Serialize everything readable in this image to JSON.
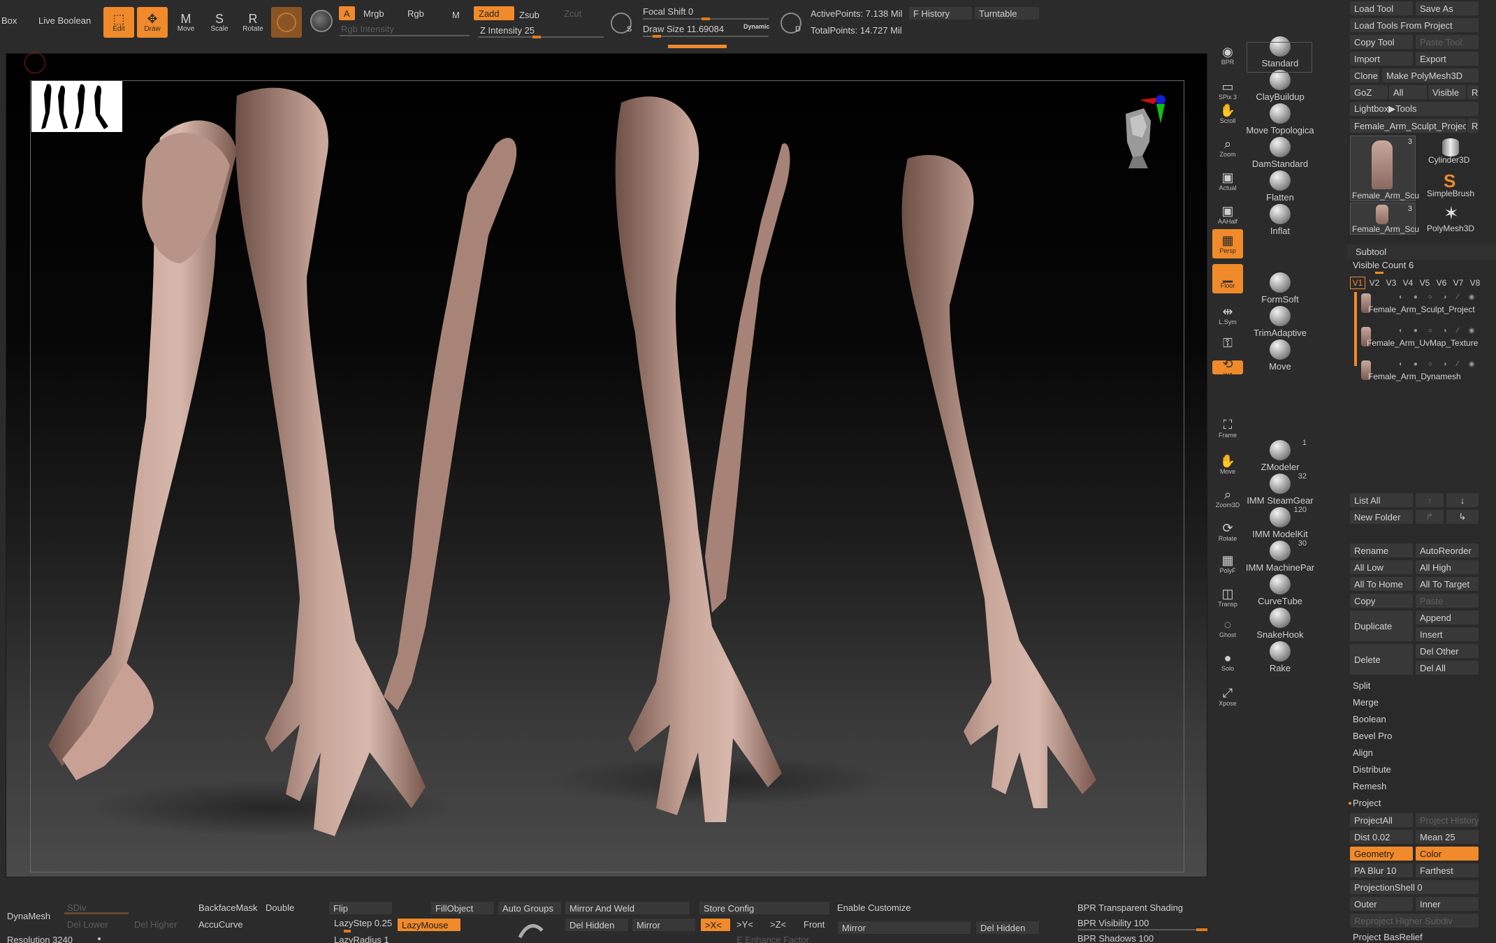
{
  "topbar": {
    "box_label": "Box",
    "live_boolean": "Live Boolean",
    "tools": [
      {
        "label": "Edit",
        "icon": "edit-icon",
        "active": true
      },
      {
        "label": "Draw",
        "icon": "draw-icon",
        "active": true
      },
      {
        "label": "Move",
        "icon": "move-icon",
        "active": false
      },
      {
        "label": "Scale",
        "icon": "scale-icon",
        "active": false
      },
      {
        "label": "Rotate",
        "icon": "rotate-icon",
        "active": false
      }
    ],
    "a_label": "A",
    "mrgb_label": "Mrgb",
    "rgb_label": "Rgb",
    "m_label": "M",
    "zadd_label": "Zadd",
    "zsub_label": "Zsub",
    "zcut_label": "Zcut",
    "rgb_intensity": "Rgb Intensity",
    "z_intensity": "Z Intensity 25",
    "focal_shift": "Focal Shift 0",
    "draw_size": "Draw Size 11.69084",
    "dynamic": "Dynamic",
    "active_points": "ActivePoints: 7.138 Mil",
    "total_points": "TotalPoints: 14.727 Mil",
    "f_history": "F History",
    "turntable": "Turntable",
    "s_key": "S",
    "d_key": "D"
  },
  "viewport": {
    "thumbnail_desc": "arms-thumbnail"
  },
  "side_icons": [
    {
      "label": "BPR",
      "icon": "bpr-icon",
      "on": false
    },
    {
      "label": "SPix 3",
      "icon": "spix-icon",
      "on": false
    },
    {
      "label": "Scroll",
      "icon": "scroll-icon",
      "on": false
    },
    {
      "label": "Zoom",
      "icon": "zoom-icon",
      "on": false
    },
    {
      "label": "Actual",
      "icon": "actual-icon",
      "on": false
    },
    {
      "label": "AAHalf",
      "icon": "aahalf-icon",
      "on": false
    },
    {
      "label": "Persp",
      "icon": "persp-icon",
      "on": true
    },
    {
      "label": "Floor",
      "icon": "floor-icon",
      "on": true
    },
    {
      "label": "L.Sym",
      "icon": "lsym-icon",
      "on": false
    },
    {
      "label": "",
      "icon": "lock-icon",
      "on": false
    },
    {
      "label": "xyz",
      "icon": "xyz-icon",
      "on": true
    },
    {
      "label": "Frame",
      "icon": "frame-icon",
      "on": false
    },
    {
      "label": "Move",
      "icon": "move-view-icon",
      "on": false
    },
    {
      "label": "Zoom3D",
      "icon": "zoom3d-icon",
      "on": false
    },
    {
      "label": "Rotate",
      "icon": "rotate-view-icon",
      "on": false
    },
    {
      "label": "PolyF",
      "icon": "polyf-icon",
      "on": false
    },
    {
      "label": "Transp",
      "icon": "transp-icon",
      "on": false
    },
    {
      "label": "Ghost",
      "icon": "ghost-icon",
      "on": false
    },
    {
      "label": "Solo",
      "icon": "solo-icon",
      "on": false
    },
    {
      "label": "Xpose",
      "icon": "xpose-icon",
      "on": false
    }
  ],
  "brushes": [
    {
      "label": "Standard",
      "count": ""
    },
    {
      "label": "ClayBuildup",
      "count": ""
    },
    {
      "label": "Move Topologica",
      "count": ""
    },
    {
      "label": "DamStandard",
      "count": ""
    },
    {
      "label": "Flatten",
      "count": ""
    },
    {
      "label": "Inflat",
      "count": ""
    },
    {
      "label": "FormSoft",
      "count": ""
    },
    {
      "label": "TrimAdaptive",
      "count": ""
    },
    {
      "label": "Move",
      "count": ""
    },
    {
      "label": "ZModeler",
      "count": "1"
    },
    {
      "label": "IMM SteamGear",
      "count": "32"
    },
    {
      "label": "IMM ModelKit",
      "count": "120"
    },
    {
      "label": "IMM MachinePar",
      "count": "30"
    },
    {
      "label": "CurveTube",
      "count": ""
    },
    {
      "label": "SnakeHook",
      "count": ""
    },
    {
      "label": "Rake",
      "count": ""
    }
  ],
  "right_panel": {
    "load_tool": "Load Tool",
    "save_as": "Save As",
    "load_tools_from_project": "Load Tools From Project",
    "copy_tool": "Copy Tool",
    "paste_tool": "Paste Tool",
    "import": "Import",
    "export": "Export",
    "clone": "Clone",
    "make_polymesh": "Make PolyMesh3D",
    "goz": "GoZ",
    "all": "All",
    "visible": "Visible",
    "r": "R",
    "lightbox_tools": "Lightbox▶Tools",
    "current_tool": "Female_Arm_Sculpt_Project",
    "tool_thumbs": [
      {
        "label": "Female_Arm_Scu",
        "count": "3"
      },
      {
        "label": "Cylinder3D",
        "count": ""
      },
      {
        "label": "Female_Arm_Scu",
        "count": ""
      },
      {
        "label": "SimpleBrush",
        "count": ""
      },
      {
        "label": "Female_Arm_Scu",
        "count": "3"
      },
      {
        "label": "PolyMesh3D",
        "count": ""
      }
    ],
    "subtool": "Subtool",
    "visible_count": "Visible Count 6",
    "versions": [
      "V1",
      "V2",
      "V3",
      "V4",
      "V5",
      "V6",
      "V7",
      "V8"
    ],
    "subtools": [
      "Female_Arm_Sculpt_Project",
      "Female_Arm_UvMap_Texture",
      "Female_Arm_Dynamesh"
    ],
    "list_all": "List All",
    "new_folder": "New Folder",
    "rename": "Rename",
    "autoreorder": "AutoReorder",
    "all_low": "All Low",
    "all_high": "All High",
    "all_to_home": "All To Home",
    "all_to_target": "All To Target",
    "copy": "Copy",
    "paste": "Paste",
    "duplicate": "Duplicate",
    "append": "Append",
    "insert": "Insert",
    "delete": "Delete",
    "del_other": "Del Other",
    "del_all": "Del All",
    "split": "Split",
    "merge": "Merge",
    "boolean": "Boolean",
    "bevel_pro": "Bevel Pro",
    "align": "Align",
    "distribute": "Distribute",
    "remesh": "Remesh",
    "project": "Project",
    "project_all": "ProjectAll",
    "project_history": "Project History",
    "dist": "Dist 0.02",
    "mean": "Mean 25",
    "geometry": "Geometry",
    "color": "Color",
    "pa_blur": "PA Blur 10",
    "farthest": "Farthest",
    "projection_shell": "ProjectionShell 0",
    "outer": "Outer",
    "inner": "Inner",
    "reproject_higher": "Reproject Higher Subdiv",
    "project_basrelief": "Project BasRelief"
  },
  "bottombar": {
    "dynamesh": "DynaMesh",
    "sdiv": "SDiv",
    "del_lower": "Del Lower",
    "del_higher": "Del Higher",
    "resolution": "Resolution 3240",
    "backface_mask": "BackfaceMask",
    "double": "Double",
    "accucurve": "AccuCurve",
    "flip": "Flip",
    "lazystep": "LazyStep 0.25",
    "lazymouse": "LazyMouse",
    "lazyradius": "LazyRadius 1",
    "fill_object": "FillObject",
    "auto_groups": "Auto Groups",
    "mirror_and_weld": "Mirror And Weld",
    "del_hidden": "Del Hidden",
    "mirror": "Mirror",
    "x_axis": ">X<",
    "y_axis": ">Y<",
    "z_axis": ">Z<",
    "front": "Front",
    "store_config": "Store Config",
    "enable_customize": "Enable Customize",
    "mirror2": "Mirror",
    "del_hidden2": "Del Hidden",
    "e_enhance": "E Enhance Factor",
    "bpr_transparent": "BPR Transparent Shading",
    "bpr_visibility": "BPR Visibility 100",
    "bpr_shadows": "BPR Shadows 100"
  },
  "colors": {
    "accent": "#f08a2a",
    "panel": "#2b2b2b",
    "button": "#383838"
  }
}
